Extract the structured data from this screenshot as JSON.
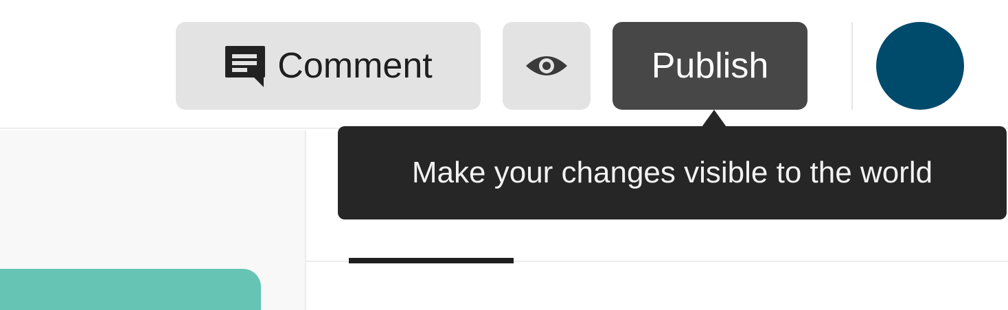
{
  "toolbar": {
    "comment_label": "Comment",
    "comment_icon": "comment-icon",
    "preview_icon": "eye-icon",
    "publish_label": "Publish"
  },
  "tooltip": {
    "text": "Make your changes visible to the world"
  },
  "colors": {
    "publish_bg": "#474747",
    "avatar_bg": "#004a6c",
    "card_accent": "#66c4b4",
    "tooltip_bg": "#262626"
  }
}
